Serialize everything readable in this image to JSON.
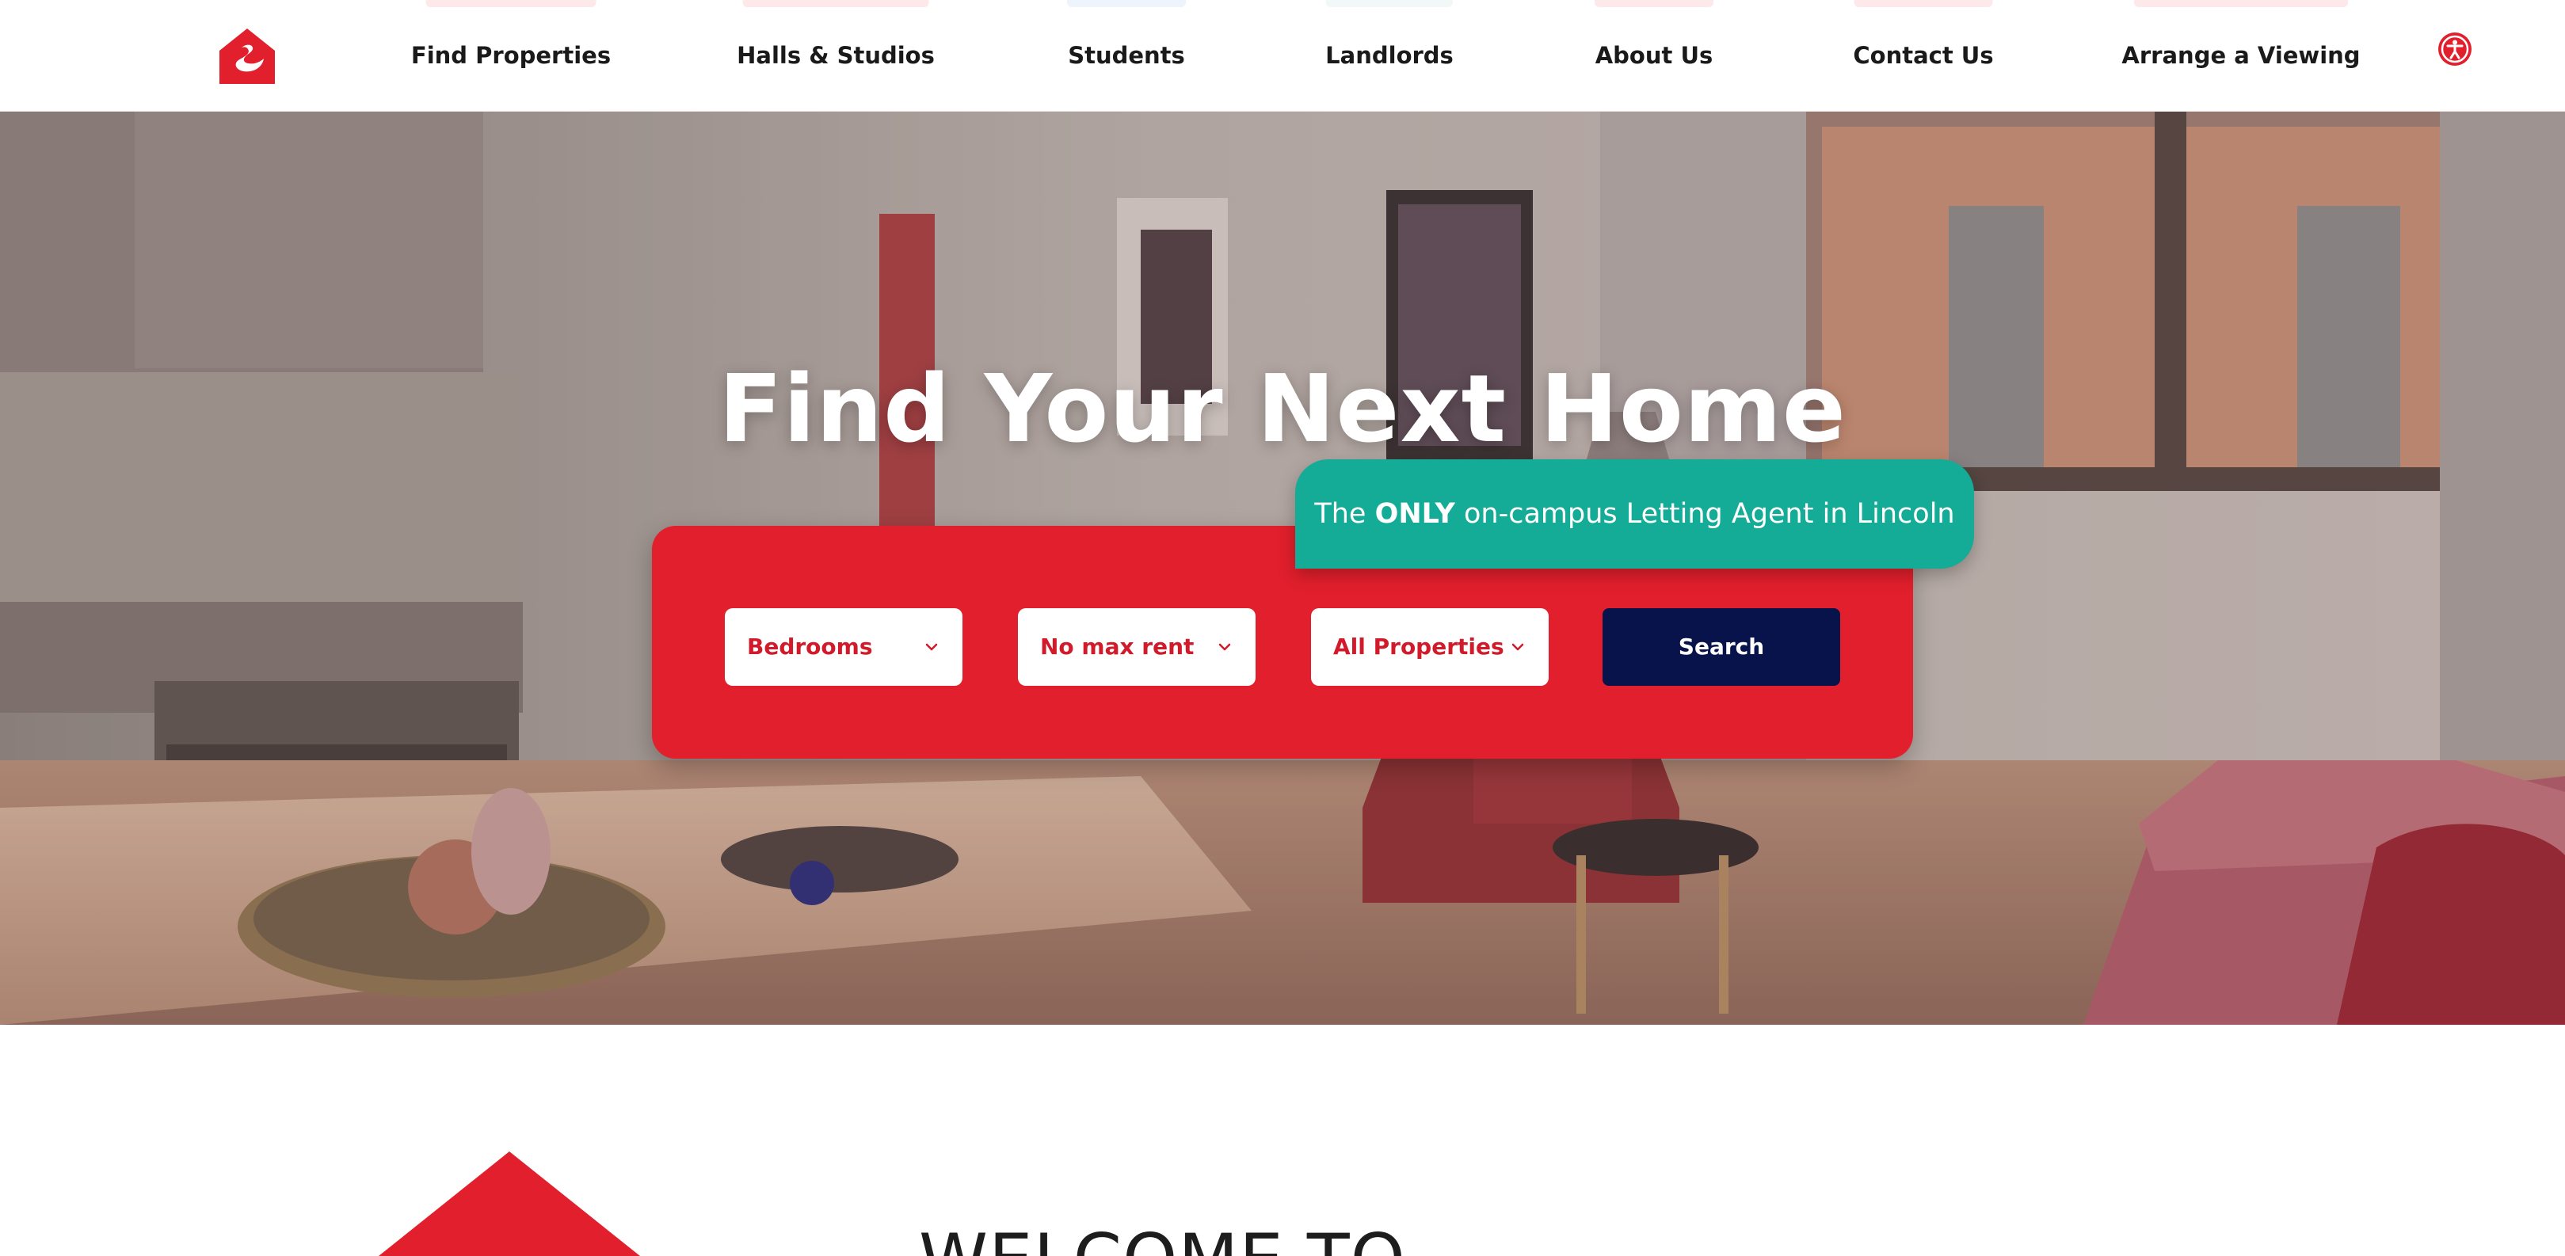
{
  "brand": {
    "logo_icon": "swan-house-logo-icon",
    "accent_color": "#e21f2c",
    "navy_color": "#07134a",
    "teal_color": "#14ab97"
  },
  "nav": {
    "items": [
      {
        "label": "Find Properties"
      },
      {
        "label": "Halls & Studios"
      },
      {
        "label": "Students"
      },
      {
        "label": "Landlords"
      },
      {
        "label": "About Us"
      },
      {
        "label": "Contact Us"
      },
      {
        "label": "Arrange a Viewing"
      }
    ],
    "accessibility_icon": "accessibility-icon"
  },
  "hero": {
    "title": "Find Your Next Home",
    "tagline_prefix": "The ",
    "tagline_emphasis": "ONLY",
    "tagline_suffix": " on-campus Letting Agent in Lincoln",
    "filters": {
      "bedrooms": "Bedrooms",
      "max_rent": "No max rent",
      "property_type": "All Properties"
    },
    "search_label": "Search",
    "chevron_icon": "chevron-down-icon"
  },
  "welcome": {
    "title": "WELCOME TO"
  }
}
